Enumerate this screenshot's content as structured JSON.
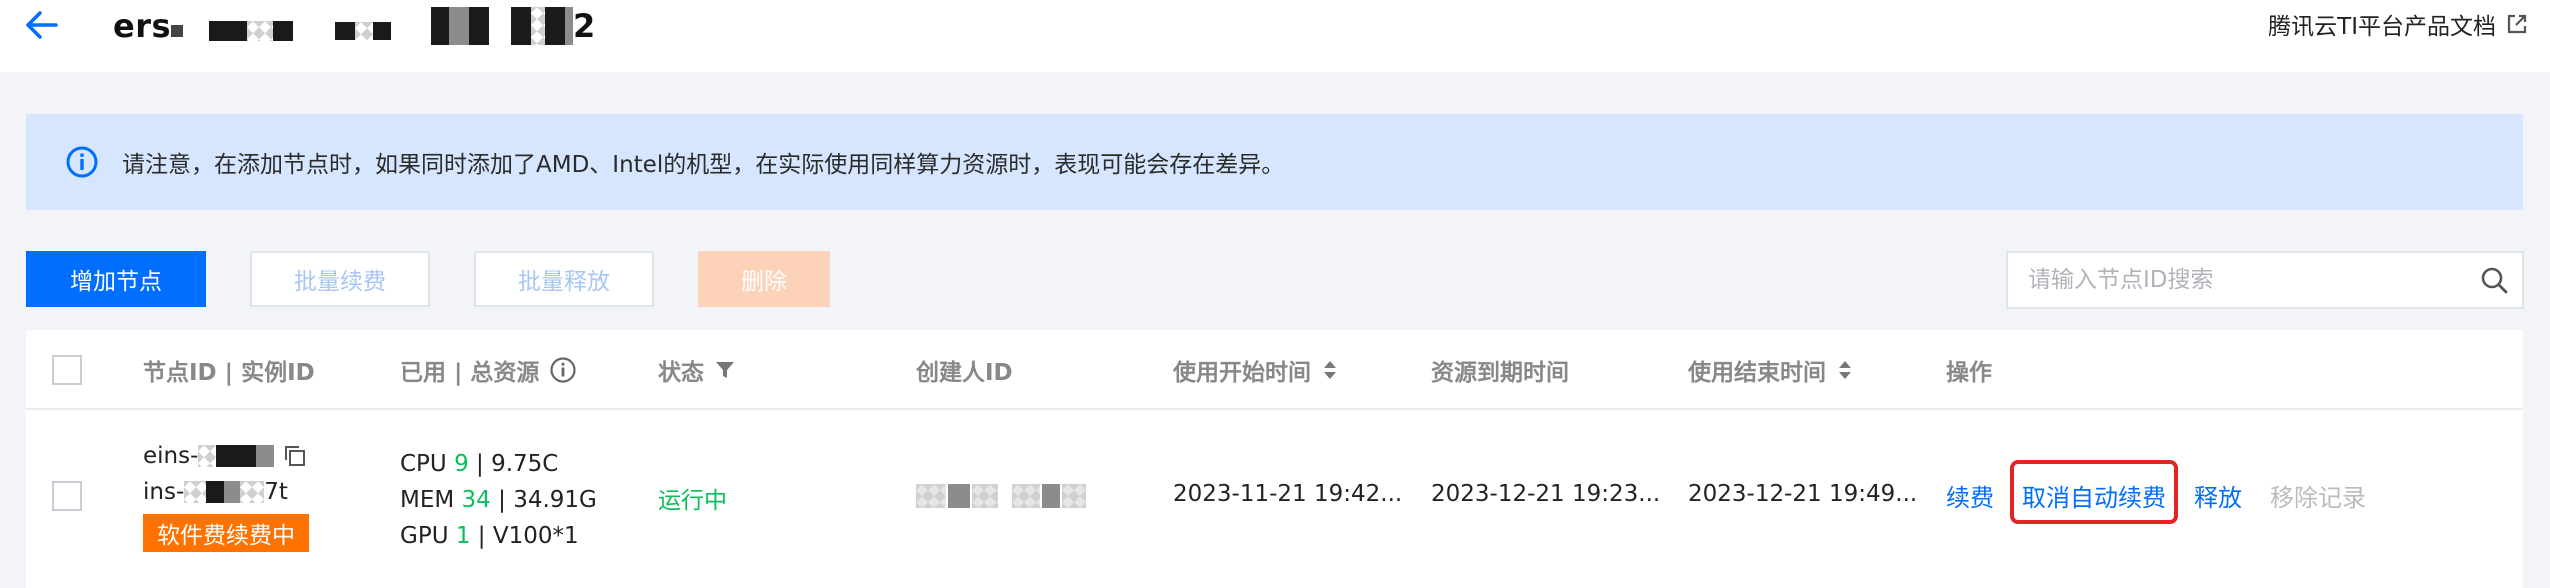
{
  "header": {
    "title_prefix": "ers",
    "title_suffix": "2",
    "doc_link_label": "腾讯云TI平台产品文档"
  },
  "alert": {
    "text": "请注意，在添加节点时，如果同时添加了AMD、Intel的机型，在实际使用同样算力资源时，表现可能会存在差异。"
  },
  "toolbar": {
    "add_node": "增加节点",
    "batch_renew": "批量续费",
    "batch_release": "批量释放",
    "delete": "删除"
  },
  "search": {
    "placeholder": "请输入节点ID搜索"
  },
  "table": {
    "headers": {
      "node_id": "节点ID | 实例ID",
      "resources": "已用 | 总资源",
      "status": "状态",
      "creator": "创建人ID",
      "start_time": "使用开始时间",
      "expire_time": "资源到期时间",
      "end_time": "使用结束时间",
      "actions": "操作"
    },
    "rows": [
      {
        "node_id_prefix": "eins-",
        "instance_id_prefix": "ins-",
        "instance_id_suffix": "7t",
        "badge": "软件费续费中",
        "cpu_label": "CPU",
        "cpu_used": "9",
        "cpu_total": "| 9.75C",
        "mem_label": "MEM",
        "mem_used": "34",
        "mem_total": "| 34.91G",
        "gpu_label": "GPU",
        "gpu_used": "1",
        "gpu_total": "| V100*1",
        "status": "运行中",
        "start_time": "2023-11-21 19:42...",
        "expire_time": "2023-12-21 19:23...",
        "end_time": "2023-12-21 19:49...",
        "actions": {
          "renew": "续费",
          "cancel_auto_renew": "取消自动续费",
          "release": "释放",
          "remove_record": "移除记录"
        }
      }
    ]
  },
  "colors": {
    "primary": "#006eff",
    "success": "#0abf5b",
    "warning": "#ff7200",
    "highlight": "#e42424",
    "alert_bg": "#d5e6fe"
  }
}
